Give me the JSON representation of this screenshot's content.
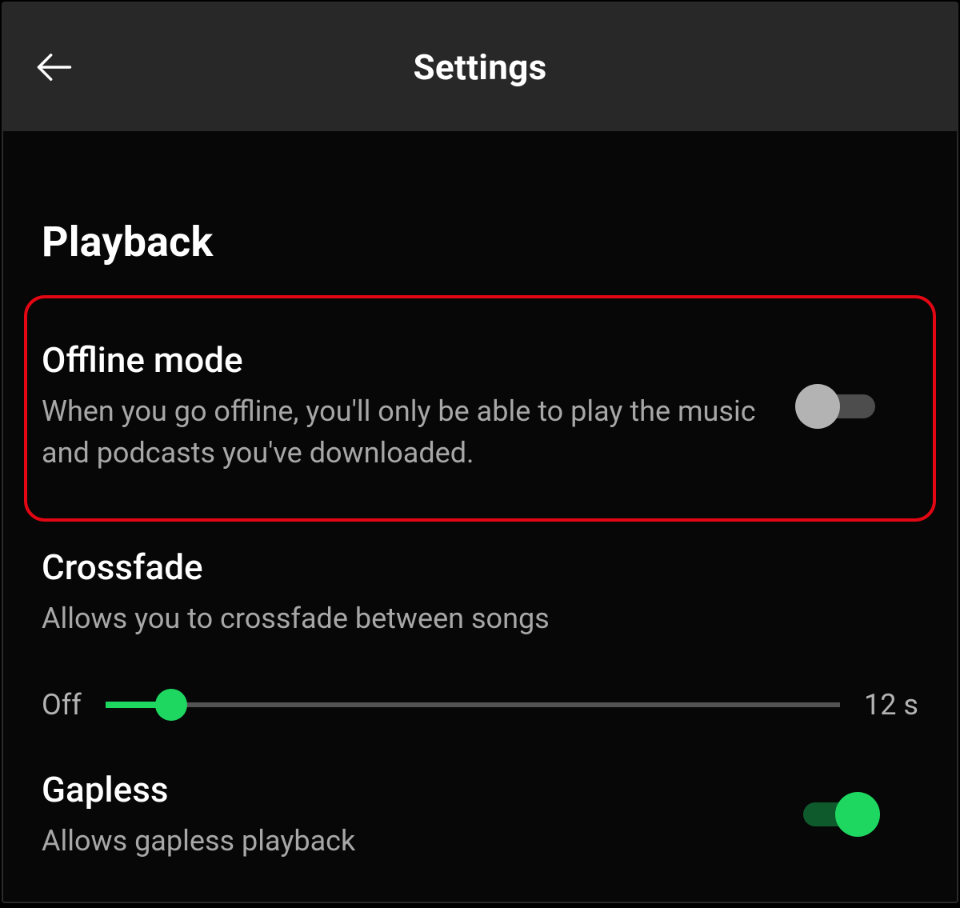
{
  "header": {
    "title": "Settings"
  },
  "section": {
    "title": "Playback"
  },
  "offline": {
    "title": "Offline mode",
    "desc": "When you go offline, you'll only be able to play the music and podcasts you've downloaded.",
    "enabled": false
  },
  "crossfade": {
    "title": "Crossfade",
    "desc": "Allows you to crossfade between songs",
    "min_label": "Off",
    "max_label": "12 s",
    "value_percent": 9
  },
  "gapless": {
    "title": "Gapless",
    "desc": "Allows gapless playback",
    "enabled": true
  },
  "colors": {
    "accent": "#1ed760",
    "highlight_border": "#e30613"
  }
}
